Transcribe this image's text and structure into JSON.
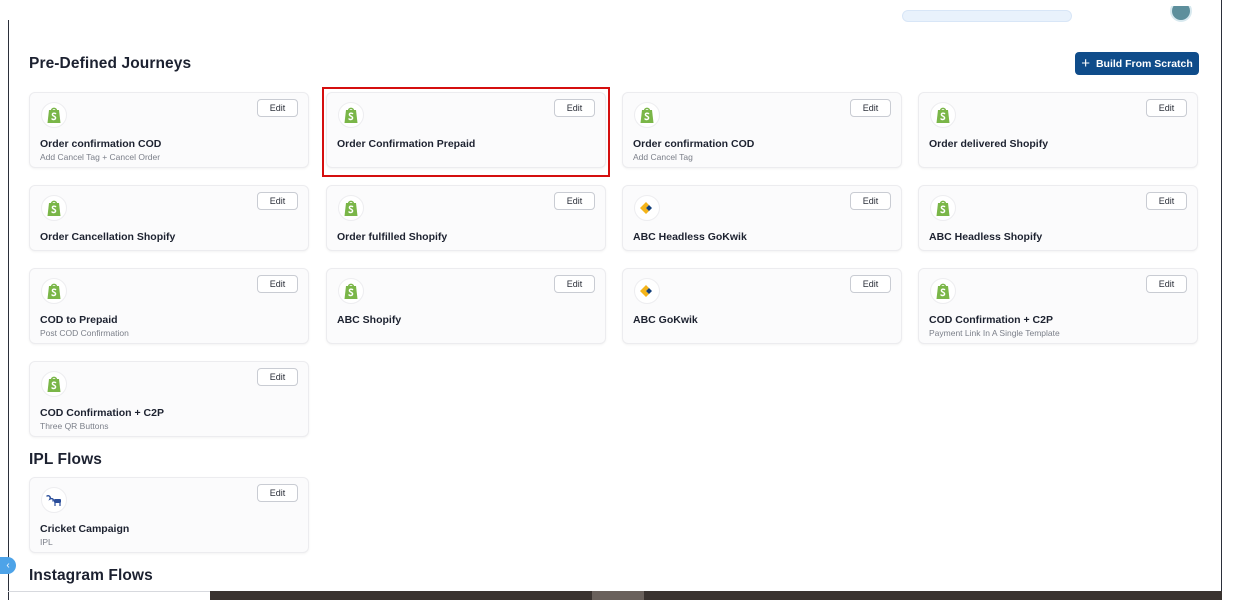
{
  "header": {
    "build_button_label": "Build From Scratch",
    "build_button_icon": "plus-icon"
  },
  "sections": {
    "predefined": {
      "title": "Pre-Defined Journeys"
    },
    "ipl": {
      "title": "IPL Flows"
    },
    "instagram": {
      "title": "Instagram Flows"
    }
  },
  "edit_label": "Edit",
  "cards": [
    {
      "title": "Order confirmation COD",
      "subtitle": "Add Cancel Tag + Cancel Order",
      "icon": "shopify-icon"
    },
    {
      "title": "Order Confirmation Prepaid",
      "subtitle": "",
      "icon": "shopify-icon",
      "highlighted": true
    },
    {
      "title": "Order confirmation COD",
      "subtitle": "Add Cancel Tag",
      "icon": "shopify-icon"
    },
    {
      "title": "Order delivered Shopify",
      "subtitle": "",
      "icon": "shopify-icon"
    },
    {
      "title": "Order Cancellation Shopify",
      "subtitle": "",
      "icon": "shopify-icon"
    },
    {
      "title": "Order fulfilled Shopify",
      "subtitle": "",
      "icon": "shopify-icon"
    },
    {
      "title": "ABC Headless GoKwik",
      "subtitle": "",
      "icon": "gokwik-icon"
    },
    {
      "title": "ABC Headless Shopify",
      "subtitle": "",
      "icon": "shopify-icon"
    },
    {
      "title": "COD to Prepaid",
      "subtitle": "Post COD Confirmation",
      "icon": "shopify-icon"
    },
    {
      "title": "ABC Shopify",
      "subtitle": "",
      "icon": "shopify-icon"
    },
    {
      "title": "ABC GoKwik",
      "subtitle": "",
      "icon": "gokwik-icon"
    },
    {
      "title": "COD Confirmation + C2P",
      "subtitle": "Payment Link In A Single Template",
      "icon": "shopify-icon"
    },
    {
      "title": "COD Confirmation + C2P",
      "subtitle": "Three QR Buttons",
      "icon": "shopify-icon"
    }
  ],
  "ipl_cards": [
    {
      "title": "Cricket Campaign",
      "subtitle": "IPL",
      "icon": "cricket-icon"
    }
  ],
  "colors": {
    "primary": "#0f4c8a",
    "highlight": "#d50f0f",
    "shopify_green": "#7ab648",
    "gokwik_yellow": "#f4b41a",
    "gokwik_blue": "#123f7a"
  }
}
